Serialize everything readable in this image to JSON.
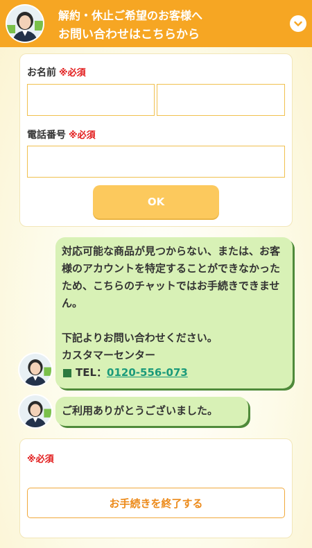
{
  "header": {
    "line1": "解約・休止ご希望のお客様へ",
    "line2": "お問い合わせはこちらから",
    "toggle_icon": "chevron-down-icon"
  },
  "form": {
    "name_label": "お名前",
    "phone_label": "電話番号",
    "required_mark": "※必須",
    "last_name_value": "",
    "first_name_value": "",
    "phone_value": "",
    "ok_label": "OK"
  },
  "chat": {
    "message_body": "対応可能な商品が見つからない、または、お客様のアカウントを特定することができなかったため、こちらのチャットではお手続きできません。\n\n下記よりお問い合わせください。\nカスタマーセンター",
    "tel_prefix": "TEL：",
    "tel_number": "0120-556-073",
    "thanks": "ご利用ありがとうございました。"
  },
  "end": {
    "required_mark": "※必須",
    "button_label": "お手続きを終了する"
  },
  "colors": {
    "header_bg": "#f6a623",
    "bubble_bg": "#d8f1b6",
    "required": "#e21b1b",
    "link": "#1a9a7a",
    "end_button_text": "#ec8a1a"
  }
}
